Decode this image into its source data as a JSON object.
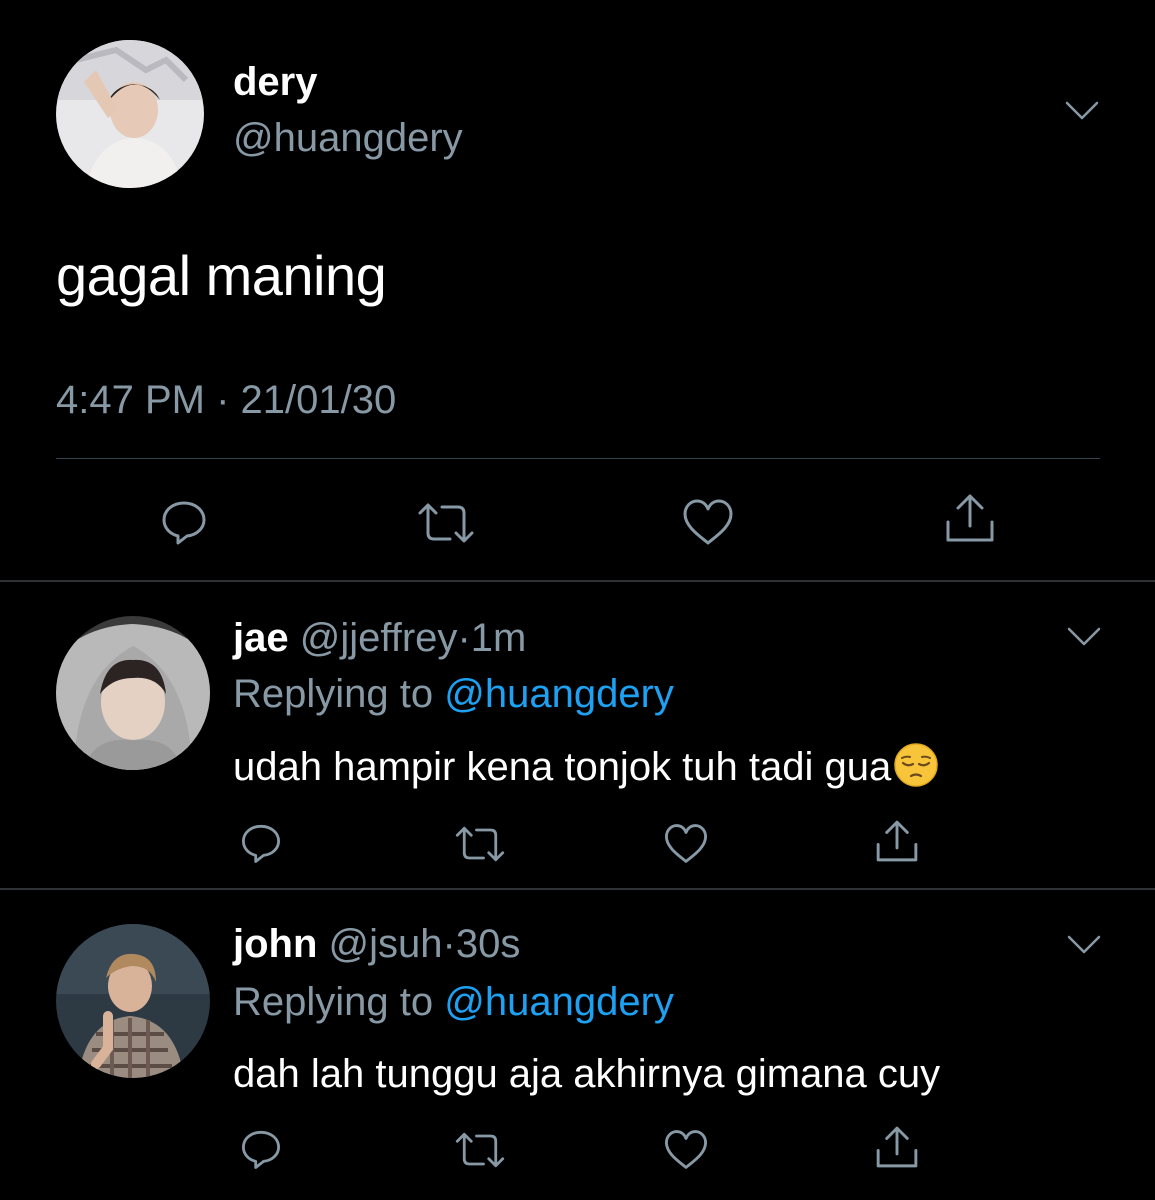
{
  "main_tweet": {
    "author_name": "dery",
    "author_handle": "@huangdery",
    "text": "gagal maning",
    "time": "4:47 PM",
    "separator": "·",
    "date": "21/01/30",
    "avatar_icon": "profile-photo",
    "menu_icon": "chevron-down-icon",
    "actions": [
      "reply-icon",
      "retweet-icon",
      "like-icon",
      "share-icon"
    ]
  },
  "replies": [
    {
      "author_name": "jae",
      "author_handle": "@jjeffrey",
      "separator": "·",
      "age": "1m",
      "replying_prefix": "Replying to ",
      "replying_to": "@huangdery",
      "text": "udah hampir kena tonjok tuh tadi gua",
      "emoji": "pensive-face-emoji"
    },
    {
      "author_name": "john",
      "author_handle": "@jsuh",
      "separator": "·",
      "age": "30s",
      "replying_prefix": "Replying to ",
      "replying_to": "@huangdery",
      "text": "dah lah tunggu aja akhirnya gimana cuy"
    }
  ],
  "colors": {
    "background": "#000000",
    "primary_text": "#ffffff",
    "secondary_text": "#8899a6",
    "link": "#1da1f2",
    "divider": "#2f3336",
    "icon": "#8899a6"
  }
}
